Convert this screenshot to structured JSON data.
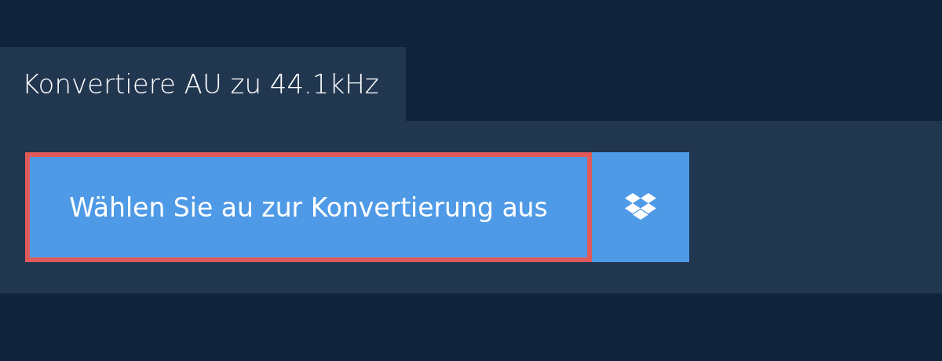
{
  "tab": {
    "title": "Konvertiere AU zu 44.1kHz"
  },
  "upload_button": {
    "label": "Wählen Sie au zur Konvertierung aus",
    "focused": true
  },
  "cloud_button": {
    "kind": "cloud"
  }
}
